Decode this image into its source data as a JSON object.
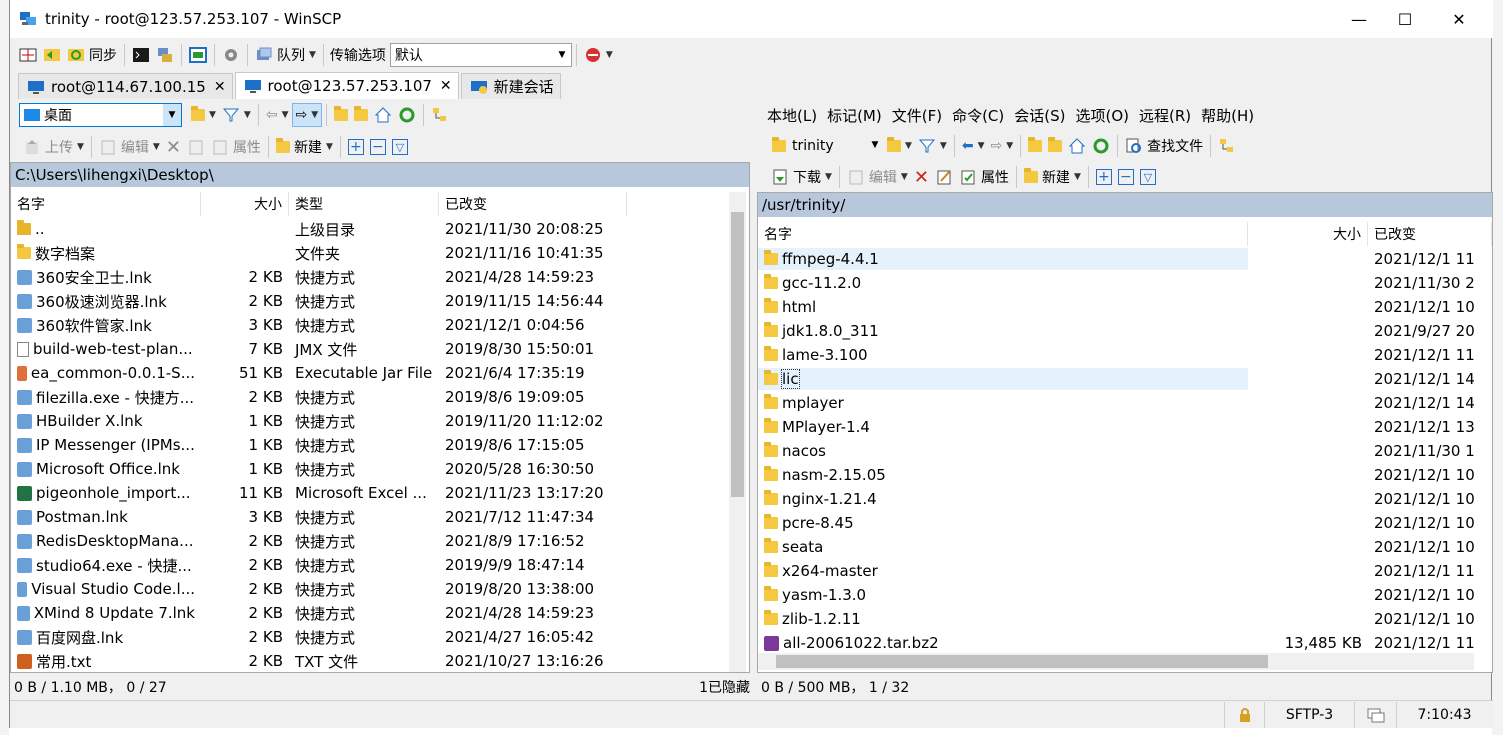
{
  "window": {
    "title": "trinity - root@123.57.253.107 - WinSCP",
    "minimize": "—",
    "maximize": "☐",
    "close": "✕"
  },
  "toolbar": {
    "sync": "同步",
    "queue": "队列",
    "transfer_label": "传输选项",
    "transfer_value": "默认"
  },
  "tabs": [
    {
      "label": "root@114.67.100.15",
      "close": "✕"
    },
    {
      "label": "root@123.57.253.107",
      "close": "✕"
    },
    {
      "label": "新建会话"
    }
  ],
  "left": {
    "drive": "桌面",
    "upload": "上传",
    "edit": "编辑",
    "props": "属性",
    "new": "新建",
    "path": "C:\\Users\\lihengxi\\Desktop\\",
    "columns": {
      "name": "名字",
      "size": "大小",
      "type": "类型",
      "modified": "已改变"
    },
    "files": [
      {
        "name": "..",
        "size": "",
        "type": "上级目录",
        "modified": "2021/11/30  20:08:25",
        "icon": "parent-dir-icon"
      },
      {
        "name": "数字档案",
        "size": "",
        "type": "文件夹",
        "modified": "2021/11/16  10:41:35",
        "icon": "folder-icon"
      },
      {
        "name": "360安全卫士.lnk",
        "size": "2 KB",
        "type": "快捷方式",
        "modified": "2021/4/28  14:59:23",
        "icon": "shortcut-icon"
      },
      {
        "name": "360极速浏览器.lnk",
        "size": "2 KB",
        "type": "快捷方式",
        "modified": "2019/11/15  14:56:44",
        "icon": "shortcut-icon"
      },
      {
        "name": "360软件管家.lnk",
        "size": "3 KB",
        "type": "快捷方式",
        "modified": "2021/12/1  0:04:56",
        "icon": "shortcut-icon"
      },
      {
        "name": "build-web-test-plan...",
        "size": "7 KB",
        "type": "JMX 文件",
        "modified": "2019/8/30  15:50:01",
        "icon": "file-icon"
      },
      {
        "name": "ea_common-0.0.1-S...",
        "size": "51 KB",
        "type": "Executable Jar File",
        "modified": "2021/6/4  17:35:19",
        "icon": "jar-icon"
      },
      {
        "name": "filezilla.exe - 快捷方...",
        "size": "2 KB",
        "type": "快捷方式",
        "modified": "2019/8/6  19:09:05",
        "icon": "shortcut-icon"
      },
      {
        "name": "HBuilder X.lnk",
        "size": "1 KB",
        "type": "快捷方式",
        "modified": "2019/11/20  11:12:02",
        "icon": "shortcut-icon"
      },
      {
        "name": "IP Messenger (IPMs...",
        "size": "1 KB",
        "type": "快捷方式",
        "modified": "2019/8/6  17:15:05",
        "icon": "shortcut-icon"
      },
      {
        "name": "Microsoft Office.lnk",
        "size": "1 KB",
        "type": "快捷方式",
        "modified": "2020/5/28  16:30:50",
        "icon": "shortcut-icon"
      },
      {
        "name": "pigeonhole_import...",
        "size": "11 KB",
        "type": "Microsoft Excel ...",
        "modified": "2021/11/23  13:17:20",
        "icon": "excel-icon"
      },
      {
        "name": "Postman.lnk",
        "size": "3 KB",
        "type": "快捷方式",
        "modified": "2021/7/12  11:47:34",
        "icon": "shortcut-icon"
      },
      {
        "name": "RedisDesktopMana...",
        "size": "2 KB",
        "type": "快捷方式",
        "modified": "2021/8/9  17:16:52",
        "icon": "shortcut-icon"
      },
      {
        "name": "studio64.exe - 快捷...",
        "size": "2 KB",
        "type": "快捷方式",
        "modified": "2019/9/9  18:47:14",
        "icon": "shortcut-icon"
      },
      {
        "name": "Visual Studio Code.l...",
        "size": "2 KB",
        "type": "快捷方式",
        "modified": "2019/8/20  13:38:00",
        "icon": "shortcut-icon"
      },
      {
        "name": "XMind 8 Update 7.lnk",
        "size": "2 KB",
        "type": "快捷方式",
        "modified": "2021/4/28  14:59:23",
        "icon": "shortcut-icon"
      },
      {
        "name": "百度网盘.lnk",
        "size": "2 KB",
        "type": "快捷方式",
        "modified": "2021/4/27  16:05:42",
        "icon": "shortcut-icon"
      },
      {
        "name": "常用.txt",
        "size": "2 KB",
        "type": "TXT 文件",
        "modified": "2021/10/27  13:16:26",
        "icon": "txt-icon"
      }
    ],
    "status": "0 B / 1.10 MB， 0 / 27",
    "hidden": "1已隐藏"
  },
  "right": {
    "menu": [
      {
        "label": "本地(L)"
      },
      {
        "label": "标记(M)"
      },
      {
        "label": "文件(F)"
      },
      {
        "label": "命令(C)"
      },
      {
        "label": "会话(S)"
      },
      {
        "label": "选项(O)"
      },
      {
        "label": "远程(R)"
      },
      {
        "label": "帮助(H)"
      }
    ],
    "dir": "trinity",
    "find": "查找文件",
    "download": "下载",
    "edit": "编辑",
    "props": "属性",
    "new": "新建",
    "path": "/usr/trinity/",
    "columns": {
      "name": "名字",
      "size": "大小",
      "modified": "已改变"
    },
    "files": [
      {
        "name": "ffmpeg-4.4.1",
        "size": "",
        "modified": "2021/12/1 11",
        "icon": "folder-icon"
      },
      {
        "name": "gcc-11.2.0",
        "size": "",
        "modified": "2021/11/30 2",
        "icon": "folder-icon"
      },
      {
        "name": "html",
        "size": "",
        "modified": "2021/12/1 10",
        "icon": "folder-icon"
      },
      {
        "name": "jdk1.8.0_311",
        "size": "",
        "modified": "2021/9/27 20",
        "icon": "folder-icon"
      },
      {
        "name": "lame-3.100",
        "size": "",
        "modified": "2021/12/1 11",
        "icon": "folder-icon"
      },
      {
        "name": "lic",
        "size": "",
        "modified": "2021/12/1 14",
        "icon": "folder-icon"
      },
      {
        "name": "mplayer",
        "size": "",
        "modified": "2021/12/1 14",
        "icon": "folder-icon"
      },
      {
        "name": "MPlayer-1.4",
        "size": "",
        "modified": "2021/12/1 13",
        "icon": "folder-icon"
      },
      {
        "name": "nacos",
        "size": "",
        "modified": "2021/11/30 1",
        "icon": "folder-icon"
      },
      {
        "name": "nasm-2.15.05",
        "size": "",
        "modified": "2021/12/1 10",
        "icon": "folder-icon"
      },
      {
        "name": "nginx-1.21.4",
        "size": "",
        "modified": "2021/12/1 10",
        "icon": "folder-icon"
      },
      {
        "name": "pcre-8.45",
        "size": "",
        "modified": "2021/12/1 10",
        "icon": "folder-icon"
      },
      {
        "name": "seata",
        "size": "",
        "modified": "2021/12/1 10",
        "icon": "folder-icon"
      },
      {
        "name": "x264-master",
        "size": "",
        "modified": "2021/12/1 11",
        "icon": "folder-icon"
      },
      {
        "name": "yasm-1.3.0",
        "size": "",
        "modified": "2021/12/1 10",
        "icon": "folder-icon"
      },
      {
        "name": "zlib-1.2.11",
        "size": "",
        "modified": "2021/12/1 10",
        "icon": "folder-icon"
      },
      {
        "name": "all-20061022.tar.bz2",
        "size": "13,485 KB",
        "modified": "2021/12/1 11",
        "icon": "archive-icon"
      }
    ],
    "status": "0 B / 500 MB， 1 / 32"
  },
  "statusbar": {
    "protocol": "SFTP-3",
    "time": "7:10:43"
  },
  "colors": {
    "pathbar": "#b8c8dc",
    "selection": "#e5f1fb",
    "folder": "#f5c842",
    "accent": "#0078d7"
  }
}
